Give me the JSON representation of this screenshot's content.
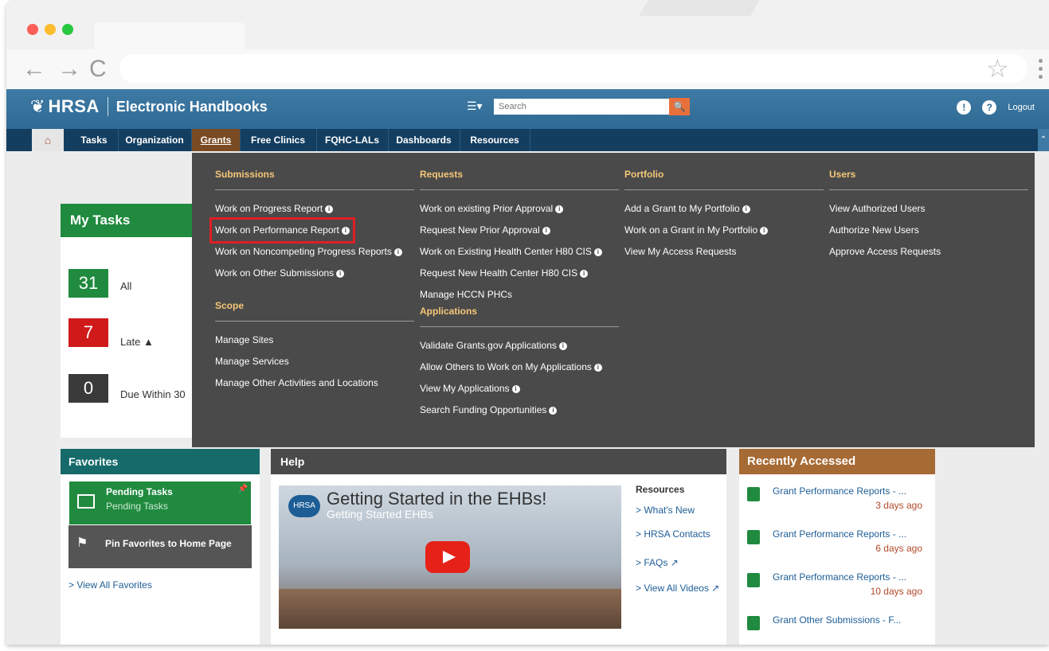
{
  "header": {
    "logo_text": "HRSA",
    "app_title": "Electronic Handbooks",
    "search_placeholder": "Search",
    "logout_label": "Logout"
  },
  "nav": {
    "items": [
      "Tasks",
      "Organization",
      "Grants",
      "Free Clinics",
      "FQHC-LALs",
      "Dashboards",
      "Resources"
    ],
    "active": "Grants"
  },
  "megamenu": {
    "submissions": {
      "title": "Submissions",
      "items": [
        "Work on Progress Report",
        "Work on Performance Report",
        "Work on Noncompeting Progress Reports",
        "Work on Other Submissions"
      ]
    },
    "scope": {
      "title": "Scope",
      "items": [
        "Manage Sites",
        "Manage Services",
        "Manage Other Activities and Locations"
      ]
    },
    "requests": {
      "title": "Requests",
      "items": [
        "Work on existing Prior Approval",
        "Request New Prior Approval",
        "Work on Existing Health Center H80 CIS",
        "Request New Health Center H80 CIS",
        "Manage HCCN PHCs"
      ]
    },
    "applications": {
      "title": "Applications",
      "items": [
        "Validate Grants.gov Applications",
        "Allow Others to Work on My Applications",
        "View My Applications",
        "Search Funding Opportunities"
      ]
    },
    "portfolio": {
      "title": "Portfolio",
      "items": [
        "Add a Grant to My Portfolio",
        "Work on a Grant in My Portfolio",
        "View My Access Requests"
      ]
    },
    "users": {
      "title": "Users",
      "items": [
        "View Authorized Users",
        "Authorize New Users",
        "Approve Access Requests"
      ]
    }
  },
  "tasks": {
    "title": "My Tasks",
    "all_count": "31",
    "all_label": "All",
    "late_count": "7",
    "late_label": "Late",
    "due_count": "0",
    "due_label": "Due Within 30"
  },
  "favorites": {
    "title": "Favorites",
    "item_title": "Pending Tasks",
    "item_sub": "Pending Tasks",
    "pin_label": "Pin Favorites to Home Page",
    "view_all": "> View All Favorites"
  },
  "help": {
    "title": "Help",
    "video_title": "Getting Started EHBs",
    "video_overlay": "Getting Started in the EHBs!",
    "resources_title": "Resources",
    "links": [
      "> What's New",
      "> HRSA Contacts",
      "> FAQs",
      "> View All Videos"
    ]
  },
  "recent": {
    "title": "Recently Accessed",
    "items": [
      {
        "title": "Grant Performance Reports - ...",
        "date": "3 days ago"
      },
      {
        "title": "Grant Performance Reports - ...",
        "date": "6 days ago"
      },
      {
        "title": "Grant Performance Reports - ...",
        "date": "10 days ago"
      },
      {
        "title": "Grant Other Submissions - F...",
        "date": ""
      }
    ]
  }
}
